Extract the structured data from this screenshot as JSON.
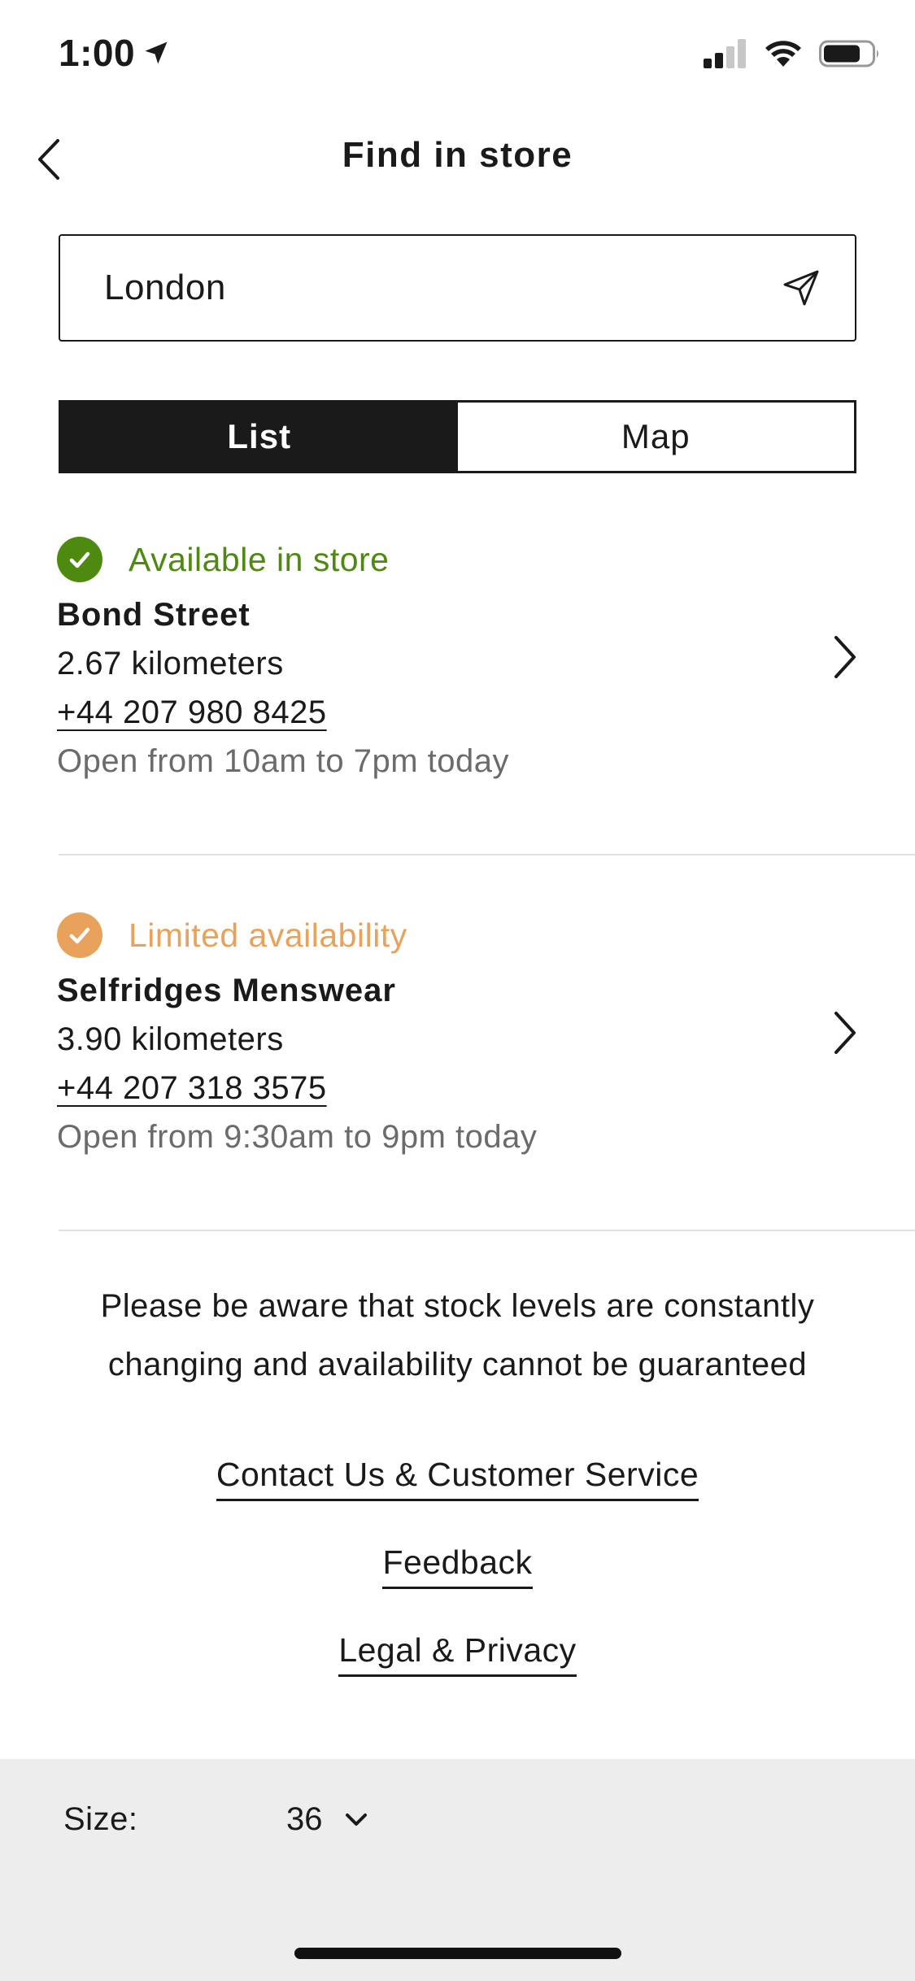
{
  "status_bar": {
    "time": "1:00",
    "icons": [
      "location-arrow-icon",
      "cellular-signal-icon",
      "wifi-icon",
      "battery-icon"
    ]
  },
  "nav": {
    "title": "Find in store",
    "back_icon": "chevron-left-icon"
  },
  "search": {
    "value": "London",
    "locate_icon": "location-arrow-icon"
  },
  "view_toggle": {
    "list_label": "List",
    "map_label": "Map",
    "selected": "List"
  },
  "stores": [
    {
      "status": "Available in store",
      "status_color": "#4f8a10",
      "name": "Bond Street",
      "distance": "2.67 kilometers",
      "phone": "+44 207 980 8425",
      "hours": "Open from 10am to 7pm today"
    },
    {
      "status": "Limited availability",
      "status_color": "#e8a25c",
      "name": "Selfridges Menswear",
      "distance": "3.90 kilometers",
      "phone": "+44 207 318 3575",
      "hours": "Open from 9:30am to 9pm today"
    }
  ],
  "notice": "Please be aware that stock levels are constantly changing and availability cannot be guaranteed",
  "footer_links": {
    "contact": "Contact Us & Customer Service",
    "feedback": "Feedback",
    "legal": "Legal & Privacy"
  },
  "size_bar": {
    "label": "Size:",
    "value": "36"
  },
  "colors": {
    "accent": "#1a1a1a",
    "available": "#4f8a10",
    "limited": "#e8a25c"
  }
}
